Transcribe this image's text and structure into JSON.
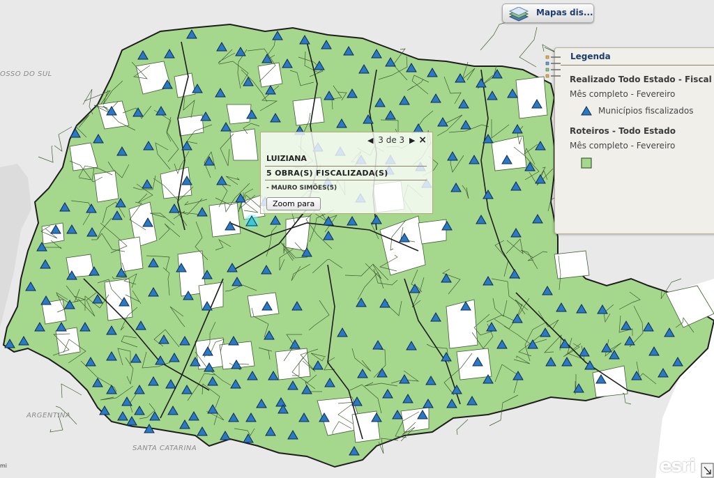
{
  "map": {
    "region_labels": [
      {
        "text": "OSSO DO SUL",
        "name": "label-mato-grosso-do-sul"
      },
      {
        "text": "ARGENTINA",
        "name": "label-argentina"
      },
      {
        "text": "SANTA CATARINA",
        "name": "label-santa-catarina"
      }
    ],
    "colors": {
      "background": "#e9e9e9",
      "audited_fill": "#a5d88d",
      "not_audited_fill": "#ffffff",
      "border": "#3e5c32",
      "region_border": "#1d1d1d",
      "marker_fill": "#2a79c2",
      "marker_stroke": "#0e2a4f",
      "ocean": "#ffffff"
    },
    "scale_text": "mi"
  },
  "toolbar": {
    "basemap_label": "Mapas dis..."
  },
  "legend": {
    "title": "Legenda",
    "layers": [
      {
        "title": "Realizado Todo Estado - Fiscal I",
        "subtitle": "Mês completo - Fevereiro",
        "item_label": "Municípios fiscalizados",
        "symbol": "triangle-icon"
      },
      {
        "title": "Roteiros - Todo Estado",
        "subtitle": "Mês completo - Fevereiro",
        "symbol": "green-square-icon"
      }
    ]
  },
  "popup": {
    "nav_text": "3 de 3",
    "prev_icon": "left-arrow-icon",
    "next_icon": "right-arrow-icon",
    "close_icon": "close-icon",
    "title": "LUIZIANA",
    "count_text": "5 OBRA(S) FISCALIZADA(S)",
    "detail_text": "- MAURO SIMÕES(5)",
    "zoom_label": "Zoom para"
  },
  "attribution": {
    "powered_by": "POWERED BY",
    "logo_text": "esri"
  }
}
